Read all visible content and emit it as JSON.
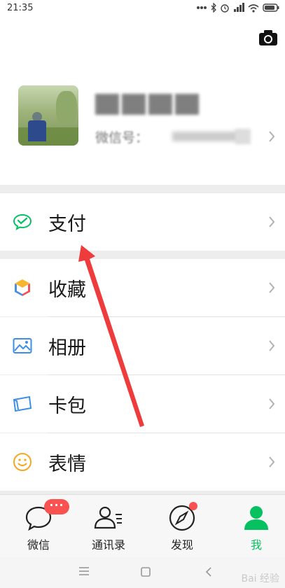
{
  "status_bar": {
    "time": "21:35"
  },
  "profile": {
    "name": "",
    "wechat_id_label": "微信号：",
    "wechat_id_value": ""
  },
  "menu": [
    {
      "label": "支付",
      "icon": "wechat-pay-icon"
    },
    {
      "label": "收藏",
      "icon": "favorites-cube-icon"
    },
    {
      "label": "相册",
      "icon": "album-icon"
    },
    {
      "label": "卡包",
      "icon": "card-wallet-icon"
    },
    {
      "label": "表情",
      "icon": "sticker-smiley-icon"
    }
  ],
  "tabbar": {
    "tabs": [
      {
        "label": "微信",
        "icon": "chat-bubble-icon",
        "badge": "···"
      },
      {
        "label": "通讯录",
        "icon": "contacts-icon"
      },
      {
        "label": "发现",
        "icon": "compass-icon"
      },
      {
        "label": "我",
        "icon": "me-person-icon",
        "active": true
      }
    ]
  },
  "colors": {
    "accent": "#07c160",
    "badge": "#fa5151",
    "arrow": "#ee3b3b"
  },
  "watermark": "Bai 经验"
}
